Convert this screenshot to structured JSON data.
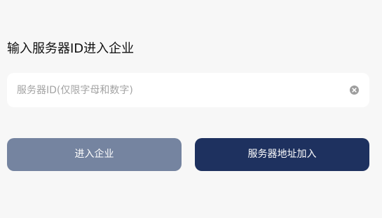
{
  "heading": "输入服务器ID进入企业",
  "server_input": {
    "value": "",
    "placeholder": "服务器ID(仅限字母和数字)",
    "clear_icon": "clear-circle-icon"
  },
  "buttons": {
    "enter_label": "进入企业",
    "server_address_label": "服务器地址加入"
  },
  "colors": {
    "background": "#f7f7f7",
    "input_background": "#ffffff",
    "enter_button": "#7584a0",
    "server_button": "#1e315f",
    "button_text": "#ffffff"
  }
}
